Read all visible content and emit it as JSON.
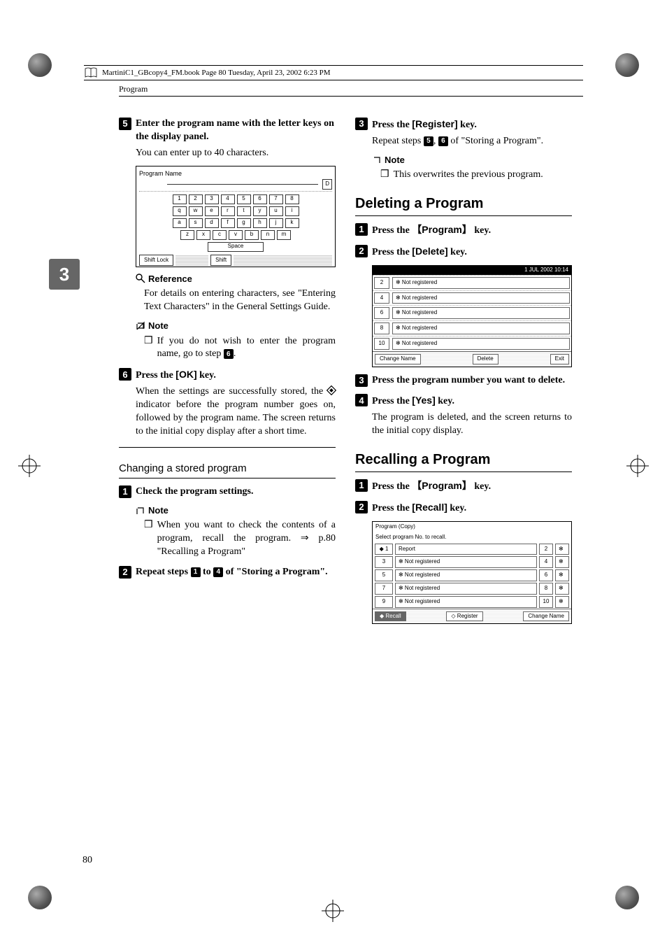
{
  "print_header": "MartiniC1_GBcopy4_FM.book  Page 80  Tuesday, April 23, 2002  6:23 PM",
  "running_head": "Program",
  "thumb_tab": "3",
  "page_number": "80",
  "left_column": {
    "step5": {
      "num": "5",
      "text_a": "Enter the program name with the letter keys on the display panel.",
      "body": "You can enter up to 40 characters."
    },
    "keyboard": {
      "title": "Program Name",
      "entered": "D",
      "row1": [
        "1",
        "2",
        "3",
        "4",
        "5",
        "6",
        "7",
        "8"
      ],
      "row2": [
        "q",
        "w",
        "e",
        "r",
        "t",
        "y",
        "u",
        "i"
      ],
      "row3": [
        "a",
        "s",
        "d",
        "f",
        "g",
        "h",
        "j",
        "k"
      ],
      "row4": [
        "z",
        "x",
        "c",
        "v",
        "b",
        "n",
        "m"
      ],
      "space": "Space",
      "shiftlock": "Shift Lock",
      "shift": "Shift"
    },
    "reference": {
      "label": "Reference",
      "body": "For details on entering characters, see \"Entering Text Characters\" in the General Settings Guide."
    },
    "note1": {
      "label": "Note",
      "body_a": "If you do not wish to enter the program name, go to step ",
      "body_step": "6",
      "body_b": "."
    },
    "step6": {
      "num": "6",
      "text_a": "Press the ",
      "key": "[OK]",
      "text_b": " key.",
      "body_a": "When the settings are successfully stored, the ",
      "body_b": " indicator before the program number goes on, followed by the program name. The screen returns to the initial copy display after a short time."
    },
    "subsection": "Changing a stored program",
    "stepA": {
      "num": "1",
      "text": "Check the program settings."
    },
    "noteA": {
      "label": "Note",
      "body_a": "When you want to check the contents of a program, recall the program. ⇒ p.80 \"Recalling a Program\""
    },
    "stepB": {
      "num": "2",
      "text_a": "Repeat steps ",
      "s1": "1",
      "text_b": " to ",
      "s2": "4",
      "text_c": " of \"Storing a Program\"."
    }
  },
  "right_column": {
    "step3top": {
      "num": "3",
      "text_a": "Press the ",
      "key": "[Register]",
      "text_b": " key.",
      "body_a": "Repeat steps ",
      "s1": "5",
      "body_b": ", ",
      "s2": "6",
      "body_c": " of \"Storing a Program\"."
    },
    "note_top": {
      "label": "Note",
      "body": "This overwrites the previous program."
    },
    "section_delete": "Deleting a Program",
    "del_step1": {
      "num": "1",
      "text_a": "Press the ",
      "key": "Program",
      "text_b": " key."
    },
    "del_step2": {
      "num": "2",
      "text_a": "Press the ",
      "key": "[Delete]",
      "text_b": " key."
    },
    "del_screenshot": {
      "header": "1 JUL  2002 10:14",
      "rows": [
        {
          "n": "2",
          "t": "✻ Not registered"
        },
        {
          "n": "4",
          "t": "✻ Not registered"
        },
        {
          "n": "6",
          "t": "✻ Not registered"
        },
        {
          "n": "8",
          "t": "✻ Not registered"
        },
        {
          "n": "10",
          "t": "✻ Not registered"
        }
      ],
      "footer": {
        "change": "Change Name",
        "delete": "Delete",
        "exit": "Exit"
      }
    },
    "del_step3": {
      "num": "3",
      "text": "Press the program number you want to delete."
    },
    "del_step4": {
      "num": "4",
      "text_a": "Press the ",
      "key": "[Yes]",
      "text_b": " key.",
      "body": "The program is deleted, and the screen returns to the initial copy display."
    },
    "section_recall": "Recalling a Program",
    "rec_step1": {
      "num": "1",
      "text_a": "Press the ",
      "key": "Program",
      "text_b": " key."
    },
    "rec_step2": {
      "num": "2",
      "text_a": "Press the ",
      "key": "[Recall]",
      "text_b": " key."
    },
    "rec_screenshot": {
      "title": "Program (Copy)",
      "subtitle": "Select program No. to recall.",
      "rows": [
        {
          "n": "1",
          "t": "Report",
          "n2": "2",
          "t2": "✻"
        },
        {
          "n": "3",
          "t": "✻ Not registered",
          "n2": "4",
          "t2": "✻"
        },
        {
          "n": "5",
          "t": "✻ Not registered",
          "n2": "6",
          "t2": "✻"
        },
        {
          "n": "7",
          "t": "✻ Not registered",
          "n2": "8",
          "t2": "✻"
        },
        {
          "n": "9",
          "t": "✻ Not registered",
          "n2": "10",
          "t2": "✻"
        }
      ],
      "footer": {
        "recall": "◆ Recall",
        "register": "◇ Register",
        "change": "Change Name"
      }
    }
  }
}
